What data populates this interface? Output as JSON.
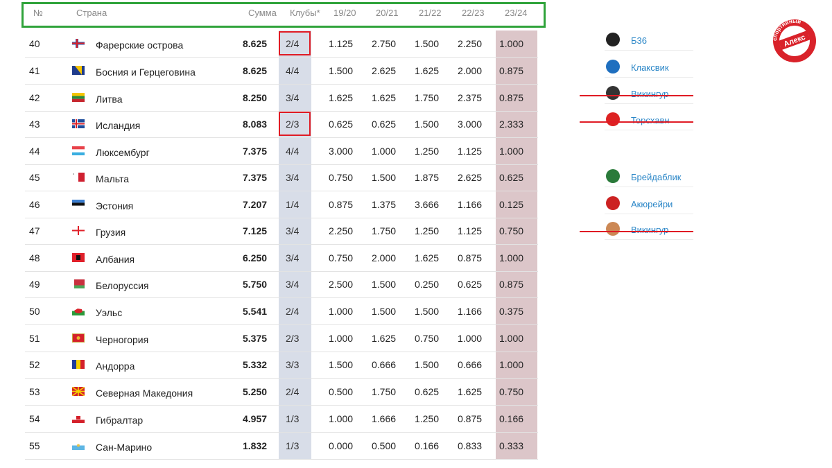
{
  "table": {
    "headers": {
      "num": "№",
      "country": "Страна",
      "sum": "Сумма",
      "clubs": "Клубы*",
      "y1": "19/20",
      "y2": "20/21",
      "y3": "21/22",
      "y4": "22/23",
      "y5": "23/24"
    },
    "rows": [
      {
        "num": "40",
        "flag": "faroe-islands",
        "country": "Фарерские острова",
        "sum": "8.625",
        "clubs": "2/4",
        "y1": "1.125",
        "y2": "2.750",
        "y3": "1.500",
        "y4": "2.250",
        "y5": "1.000",
        "highlight": true
      },
      {
        "num": "41",
        "flag": "bosnia",
        "country": "Босния и Герцеговина",
        "sum": "8.625",
        "clubs": "4/4",
        "y1": "1.500",
        "y2": "2.625",
        "y3": "1.625",
        "y4": "2.000",
        "y5": "0.875"
      },
      {
        "num": "42",
        "flag": "lithuania",
        "country": "Литва",
        "sum": "8.250",
        "clubs": "3/4",
        "y1": "1.625",
        "y2": "1.625",
        "y3": "1.750",
        "y4": "2.375",
        "y5": "0.875"
      },
      {
        "num": "43",
        "flag": "iceland",
        "country": "Исландия",
        "sum": "8.083",
        "clubs": "2/3",
        "y1": "0.625",
        "y2": "0.625",
        "y3": "1.500",
        "y4": "3.000",
        "y5": "2.333",
        "highlight": true
      },
      {
        "num": "44",
        "flag": "luxembourg",
        "country": "Люксембург",
        "sum": "7.375",
        "clubs": "4/4",
        "y1": "3.000",
        "y2": "1.000",
        "y3": "1.250",
        "y4": "1.125",
        "y5": "1.000"
      },
      {
        "num": "45",
        "flag": "malta",
        "country": "Мальта",
        "sum": "7.375",
        "clubs": "3/4",
        "y1": "0.750",
        "y2": "1.500",
        "y3": "1.875",
        "y4": "2.625",
        "y5": "0.625"
      },
      {
        "num": "46",
        "flag": "estonia",
        "country": "Эстония",
        "sum": "7.207",
        "clubs": "1/4",
        "y1": "0.875",
        "y2": "1.375",
        "y3": "3.666",
        "y4": "1.166",
        "y5": "0.125"
      },
      {
        "num": "47",
        "flag": "georgia",
        "country": "Грузия",
        "sum": "7.125",
        "clubs": "3/4",
        "y1": "2.250",
        "y2": "1.750",
        "y3": "1.250",
        "y4": "1.125",
        "y5": "0.750"
      },
      {
        "num": "48",
        "flag": "albania",
        "country": "Албания",
        "sum": "6.250",
        "clubs": "3/4",
        "y1": "0.750",
        "y2": "2.000",
        "y3": "1.625",
        "y4": "0.875",
        "y5": "1.000"
      },
      {
        "num": "49",
        "flag": "belarus",
        "country": "Белоруссия",
        "sum": "5.750",
        "clubs": "3/4",
        "y1": "2.500",
        "y2": "1.500",
        "y3": "0.250",
        "y4": "0.625",
        "y5": "0.875"
      },
      {
        "num": "50",
        "flag": "wales",
        "country": "Уэльс",
        "sum": "5.541",
        "clubs": "2/4",
        "y1": "1.000",
        "y2": "1.500",
        "y3": "1.500",
        "y4": "1.166",
        "y5": "0.375"
      },
      {
        "num": "51",
        "flag": "montenegro",
        "country": "Черногория",
        "sum": "5.375",
        "clubs": "2/3",
        "y1": "1.000",
        "y2": "1.625",
        "y3": "0.750",
        "y4": "1.000",
        "y5": "1.000"
      },
      {
        "num": "52",
        "flag": "andorra",
        "country": "Андорра",
        "sum": "5.332",
        "clubs": "3/3",
        "y1": "1.500",
        "y2": "0.666",
        "y3": "1.500",
        "y4": "0.666",
        "y5": "1.000"
      },
      {
        "num": "53",
        "flag": "north-macedonia",
        "country": "Северная Македония",
        "sum": "5.250",
        "clubs": "2/4",
        "y1": "0.500",
        "y2": "1.750",
        "y3": "0.625",
        "y4": "1.625",
        "y5": "0.750"
      },
      {
        "num": "54",
        "flag": "gibraltar",
        "country": "Гибралтар",
        "sum": "4.957",
        "clubs": "1/3",
        "y1": "1.000",
        "y2": "1.666",
        "y3": "1.250",
        "y4": "0.875",
        "y5": "0.166"
      },
      {
        "num": "55",
        "flag": "san-marino",
        "country": "Сан-Марино",
        "sum": "1.832",
        "clubs": "1/3",
        "y1": "0.000",
        "y2": "0.500",
        "y3": "0.166",
        "y4": "0.833",
        "y5": "0.333"
      }
    ]
  },
  "faroe_clubs": [
    {
      "name": "Б36",
      "logo": "b36-logo-icon",
      "struck": false
    },
    {
      "name": "Клаксвик",
      "logo": "klaksvik-logo-icon",
      "struck": false
    },
    {
      "name": "Викингур",
      "logo": "vikingur-logo-icon",
      "struck": true
    },
    {
      "name": "Торсхавн",
      "logo": "torshavn-logo-icon",
      "struck": true
    }
  ],
  "iceland_clubs": [
    {
      "name": "Брейдаблик",
      "logo": "breidablik-logo-icon",
      "struck": false
    },
    {
      "name": "Акюрейри",
      "logo": "akureyri-logo-icon",
      "struck": false
    },
    {
      "name": "Викингур",
      "logo": "vikingur-reykjavik-logo-icon",
      "struck": true
    }
  ],
  "stamp": {
    "text": "Алекс",
    "ring_text": "спортивный"
  },
  "colors": {
    "header_border": "#2fa33a",
    "highlight": "#e01b24",
    "link": "#2a86c7",
    "clubs_col": "#d8dde8",
    "last_col": "#dcc6c9"
  }
}
